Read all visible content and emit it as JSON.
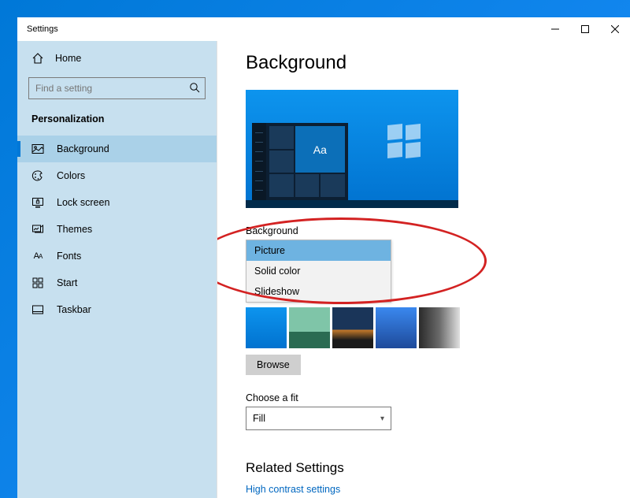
{
  "window": {
    "title": "Settings"
  },
  "sidebar": {
    "home_label": "Home",
    "search_placeholder": "Find a setting",
    "section_title": "Personalization",
    "items": [
      {
        "label": "Background"
      },
      {
        "label": "Colors"
      },
      {
        "label": "Lock screen"
      },
      {
        "label": "Themes"
      },
      {
        "label": "Fonts"
      },
      {
        "label": "Start"
      },
      {
        "label": "Taskbar"
      }
    ]
  },
  "main": {
    "page_title": "Background",
    "preview_tile_text": "Aa",
    "background_label": "Background",
    "background_options": [
      {
        "label": "Picture",
        "selected": true
      },
      {
        "label": "Solid color",
        "selected": false
      },
      {
        "label": "Slideshow",
        "selected": false
      }
    ],
    "browse_label": "Browse",
    "fit_label": "Choose a fit",
    "fit_value": "Fill",
    "related_title": "Related Settings",
    "related_links": [
      {
        "label": "High contrast settings"
      }
    ]
  }
}
